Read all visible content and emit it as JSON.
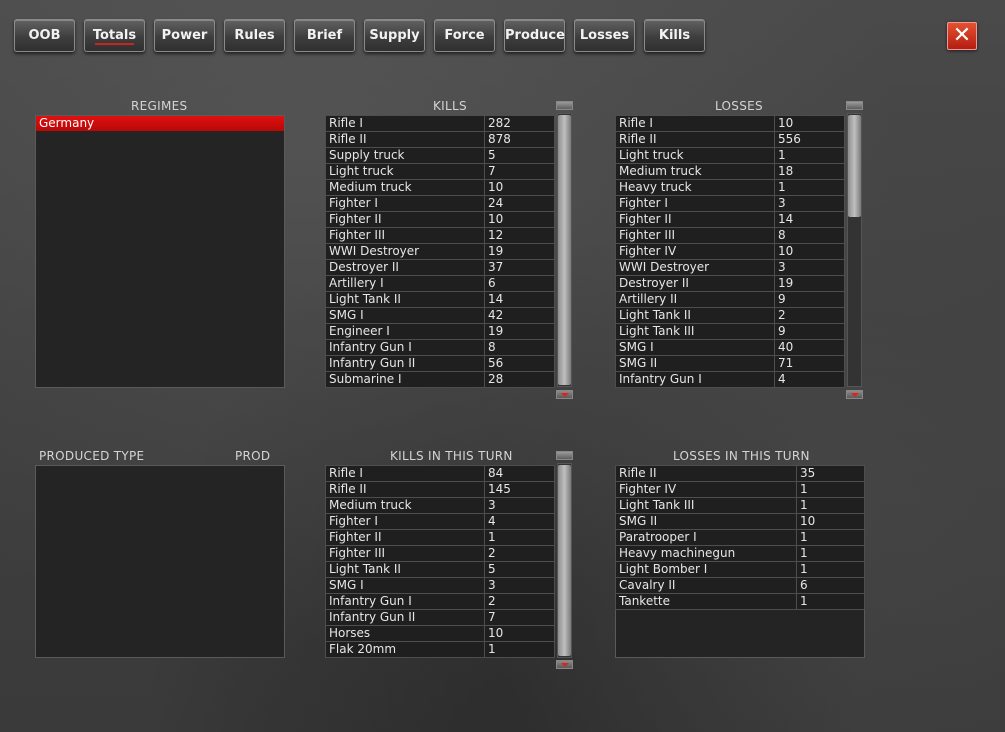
{
  "nav": {
    "buttons": [
      "OOB",
      "Totals",
      "Power",
      "Rules",
      "Brief",
      "Supply",
      "Force",
      "Produce",
      "Losses",
      "Kills"
    ],
    "active": "Totals",
    "close": "✕"
  },
  "regimes": {
    "title": "REGIMES",
    "items": [
      "Germany"
    ],
    "selected": "Germany"
  },
  "produced": {
    "title": "PRODUCED TYPE",
    "prod_label": "PROD"
  },
  "kills": {
    "title": "KILLS",
    "rows": [
      [
        "Rifle I",
        "282"
      ],
      [
        "Rifle II",
        "878"
      ],
      [
        "Supply truck",
        "5"
      ],
      [
        "Light truck",
        "7"
      ],
      [
        "Medium truck",
        "10"
      ],
      [
        "Fighter I",
        "24"
      ],
      [
        "Fighter II",
        "10"
      ],
      [
        "Fighter III",
        "12"
      ],
      [
        "WWI Destroyer",
        "19"
      ],
      [
        "Destroyer II",
        "37"
      ],
      [
        "Artillery I",
        "6"
      ],
      [
        "Light Tank II",
        "14"
      ],
      [
        "SMG I",
        "42"
      ],
      [
        "Engineer I",
        "19"
      ],
      [
        "Infantry Gun I",
        "8"
      ],
      [
        "Infantry Gun II",
        "56"
      ],
      [
        "Submarine I",
        "28"
      ]
    ]
  },
  "losses": {
    "title": "LOSSES",
    "rows": [
      [
        "Rifle I",
        "10"
      ],
      [
        "Rifle II",
        "556"
      ],
      [
        "Light truck",
        "1"
      ],
      [
        "Medium truck",
        "18"
      ],
      [
        "Heavy truck",
        "1"
      ],
      [
        "Fighter I",
        "3"
      ],
      [
        "Fighter II",
        "14"
      ],
      [
        "Fighter III",
        "8"
      ],
      [
        "Fighter IV",
        "10"
      ],
      [
        "WWI Destroyer",
        "3"
      ],
      [
        "Destroyer II",
        "19"
      ],
      [
        "Artillery II",
        "9"
      ],
      [
        "Light Tank II",
        "2"
      ],
      [
        "Light Tank III",
        "9"
      ],
      [
        "SMG I",
        "40"
      ],
      [
        "SMG II",
        "71"
      ],
      [
        "Infantry Gun I",
        "4"
      ]
    ]
  },
  "kills_turn": {
    "title": "KILLS IN THIS TURN",
    "rows": [
      [
        "Rifle I",
        "84"
      ],
      [
        "Rifle II",
        "145"
      ],
      [
        "Medium truck",
        "3"
      ],
      [
        "Fighter I",
        "4"
      ],
      [
        "Fighter II",
        "1"
      ],
      [
        "Fighter III",
        "2"
      ],
      [
        "Light Tank II",
        "5"
      ],
      [
        "SMG I",
        "3"
      ],
      [
        "Infantry Gun I",
        "2"
      ],
      [
        "Infantry Gun II",
        "7"
      ],
      [
        "Horses",
        "10"
      ],
      [
        "Flak 20mm",
        "1"
      ]
    ]
  },
  "losses_turn": {
    "title": "LOSSES IN THIS TURN",
    "rows": [
      [
        "Rifle II",
        "35"
      ],
      [
        "Fighter IV",
        "1"
      ],
      [
        "Light Tank III",
        "1"
      ],
      [
        "SMG II",
        "10"
      ],
      [
        "Paratrooper I",
        "1"
      ],
      [
        "Heavy machinegun",
        "1"
      ],
      [
        "Light Bomber I",
        "1"
      ],
      [
        "Cavalry II",
        "6"
      ],
      [
        "Tankette",
        "1"
      ]
    ]
  }
}
